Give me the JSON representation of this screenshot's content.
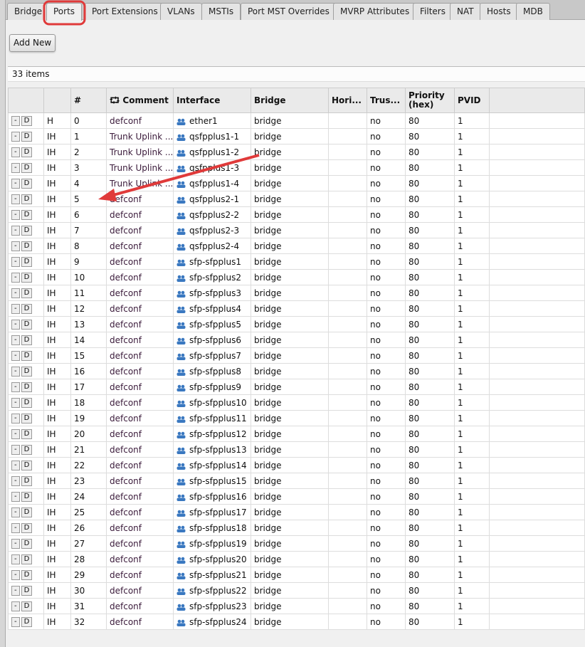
{
  "tabs": [
    "Bridge",
    "Ports",
    "Port Extensions",
    "VLANs",
    "MSTIs",
    "Port MST Overrides",
    "MVRP Attributes",
    "Filters",
    "NAT",
    "Hosts",
    "MDB"
  ],
  "active_tab": "Ports",
  "add_new_label": "Add New",
  "item_count": "33 items",
  "columns": [
    "",
    "",
    "#",
    "Comment",
    "Interface",
    "Bridge",
    "Hori...",
    "Trus...",
    "Priority (hex)",
    "PVID",
    ""
  ],
  "row_buttons": [
    "-",
    "D"
  ],
  "rows": [
    [
      "H",
      "0",
      "defconf",
      "ether1",
      "bridge",
      "",
      "no",
      "80",
      "1"
    ],
    [
      "IH",
      "1",
      "Trunk Uplink ...",
      "qsfpplus1-1",
      "bridge",
      "",
      "no",
      "80",
      "1"
    ],
    [
      "IH",
      "2",
      "Trunk Uplink ...",
      "qsfpplus1-2",
      "bridge",
      "",
      "no",
      "80",
      "1"
    ],
    [
      "IH",
      "3",
      "Trunk Uplink ...",
      "qsfpplus1-3",
      "bridge",
      "",
      "no",
      "80",
      "1"
    ],
    [
      "IH",
      "4",
      "Trunk Uplink ...",
      "qsfpplus1-4",
      "bridge",
      "",
      "no",
      "80",
      "1"
    ],
    [
      "IH",
      "5",
      "defconf",
      "qsfpplus2-1",
      "bridge",
      "",
      "no",
      "80",
      "1"
    ],
    [
      "IH",
      "6",
      "defconf",
      "qsfpplus2-2",
      "bridge",
      "",
      "no",
      "80",
      "1"
    ],
    [
      "IH",
      "7",
      "defconf",
      "qsfpplus2-3",
      "bridge",
      "",
      "no",
      "80",
      "1"
    ],
    [
      "IH",
      "8",
      "defconf",
      "qsfpplus2-4",
      "bridge",
      "",
      "no",
      "80",
      "1"
    ],
    [
      "IH",
      "9",
      "defconf",
      "sfp-sfpplus1",
      "bridge",
      "",
      "no",
      "80",
      "1"
    ],
    [
      "IH",
      "10",
      "defconf",
      "sfp-sfpplus2",
      "bridge",
      "",
      "no",
      "80",
      "1"
    ],
    [
      "IH",
      "11",
      "defconf",
      "sfp-sfpplus3",
      "bridge",
      "",
      "no",
      "80",
      "1"
    ],
    [
      "IH",
      "12",
      "defconf",
      "sfp-sfpplus4",
      "bridge",
      "",
      "no",
      "80",
      "1"
    ],
    [
      "IH",
      "13",
      "defconf",
      "sfp-sfpplus5",
      "bridge",
      "",
      "no",
      "80",
      "1"
    ],
    [
      "IH",
      "14",
      "defconf",
      "sfp-sfpplus6",
      "bridge",
      "",
      "no",
      "80",
      "1"
    ],
    [
      "IH",
      "15",
      "defconf",
      "sfp-sfpplus7",
      "bridge",
      "",
      "no",
      "80",
      "1"
    ],
    [
      "IH",
      "16",
      "defconf",
      "sfp-sfpplus8",
      "bridge",
      "",
      "no",
      "80",
      "1"
    ],
    [
      "IH",
      "17",
      "defconf",
      "sfp-sfpplus9",
      "bridge",
      "",
      "no",
      "80",
      "1"
    ],
    [
      "IH",
      "18",
      "defconf",
      "sfp-sfpplus10",
      "bridge",
      "",
      "no",
      "80",
      "1"
    ],
    [
      "IH",
      "19",
      "defconf",
      "sfp-sfpplus11",
      "bridge",
      "",
      "no",
      "80",
      "1"
    ],
    [
      "IH",
      "20",
      "defconf",
      "sfp-sfpplus12",
      "bridge",
      "",
      "no",
      "80",
      "1"
    ],
    [
      "IH",
      "21",
      "defconf",
      "sfp-sfpplus13",
      "bridge",
      "",
      "no",
      "80",
      "1"
    ],
    [
      "IH",
      "22",
      "defconf",
      "sfp-sfpplus14",
      "bridge",
      "",
      "no",
      "80",
      "1"
    ],
    [
      "IH",
      "23",
      "defconf",
      "sfp-sfpplus15",
      "bridge",
      "",
      "no",
      "80",
      "1"
    ],
    [
      "IH",
      "24",
      "defconf",
      "sfp-sfpplus16",
      "bridge",
      "",
      "no",
      "80",
      "1"
    ],
    [
      "IH",
      "25",
      "defconf",
      "sfp-sfpplus17",
      "bridge",
      "",
      "no",
      "80",
      "1"
    ],
    [
      "IH",
      "26",
      "defconf",
      "sfp-sfpplus18",
      "bridge",
      "",
      "no",
      "80",
      "1"
    ],
    [
      "IH",
      "27",
      "defconf",
      "sfp-sfpplus19",
      "bridge",
      "",
      "no",
      "80",
      "1"
    ],
    [
      "IH",
      "28",
      "defconf",
      "sfp-sfpplus20",
      "bridge",
      "",
      "no",
      "80",
      "1"
    ],
    [
      "IH",
      "29",
      "defconf",
      "sfp-sfpplus21",
      "bridge",
      "",
      "no",
      "80",
      "1"
    ],
    [
      "IH",
      "30",
      "defconf",
      "sfp-sfpplus22",
      "bridge",
      "",
      "no",
      "80",
      "1"
    ],
    [
      "IH",
      "31",
      "defconf",
      "sfp-sfpplus23",
      "bridge",
      "",
      "no",
      "80",
      "1"
    ],
    [
      "IH",
      "32",
      "defconf",
      "sfp-sfpplus24",
      "bridge",
      "",
      "no",
      "80",
      "1"
    ]
  ],
  "colors": {
    "annotation": "#e03a3a",
    "interface_icon": "#3a78c0"
  }
}
